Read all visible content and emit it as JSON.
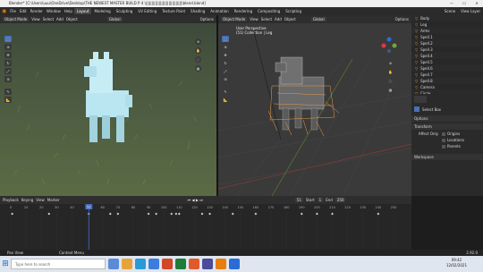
{
  "titlebar": {
    "text": "Blender* [C:\\Users\\uuu\\OneDrive\\Desktop\\THE NEWEST MASTER BUILD P 4 \\||||||||||||||||||||||||||||||\\blend.blend]"
  },
  "menubar": {
    "items": [
      "File",
      "Edit",
      "Render",
      "Window",
      "Help"
    ],
    "workspaces": [
      "Layout",
      "Modeling",
      "Sculpting",
      "UV Editing",
      "Texture Paint",
      "Shading",
      "Animation",
      "Rendering",
      "Compositing",
      "Scripting"
    ],
    "active": "Layout",
    "scene": "Scene",
    "view_layer": "View Layer"
  },
  "left_viewport": {
    "mode": "Object Mode",
    "menus": [
      "View",
      "Select",
      "Add",
      "Object"
    ],
    "transform": "Global",
    "options": "Options"
  },
  "right_viewport": {
    "mode": "Object Mode",
    "menus": [
      "View",
      "Select",
      "Add",
      "Object"
    ],
    "transform": "Global",
    "options": "Options",
    "overlay_line1": "User Perspective",
    "overlay_line2": "(51) Collection | Leg"
  },
  "outliner": {
    "rows": [
      {
        "name": "Body",
        "kind": "obj"
      },
      {
        "name": "Leg",
        "kind": "obj"
      },
      {
        "name": "Arms",
        "kind": "obj"
      },
      {
        "name": "Spell.1",
        "kind": "obj"
      },
      {
        "name": "Spell.2",
        "kind": "obj"
      },
      {
        "name": "Spell.3",
        "kind": "obj"
      },
      {
        "name": "Spell.4",
        "kind": "obj"
      },
      {
        "name": "Spell.5",
        "kind": "obj"
      },
      {
        "name": "Spell.6",
        "kind": "obj"
      },
      {
        "name": "Spell.7",
        "kind": "obj"
      },
      {
        "name": "Spell.8",
        "kind": "obj"
      },
      {
        "name": "Camera",
        "kind": "obj"
      },
      {
        "name": "Circle",
        "kind": "obj"
      },
      {
        "name": "Cube",
        "kind": "obj"
      }
    ]
  },
  "props": {
    "tool_label": "Select Box",
    "options": "Options",
    "transform": "Transform",
    "affect_only": "Affect Only",
    "checks": [
      "Origins",
      "Locations",
      "Parents"
    ],
    "workspace": "Workspace"
  },
  "timeline": {
    "menus": [
      "Playback",
      "Keying",
      "View",
      "Marker"
    ],
    "current": "51",
    "start_label": "Start",
    "start": "1",
    "end_label": "End",
    "end": "250",
    "ticks": [
      "0",
      "10",
      "20",
      "30",
      "40",
      "50",
      "60",
      "70",
      "80",
      "90",
      "100",
      "110",
      "120",
      "130",
      "140",
      "150",
      "160",
      "170",
      "180",
      "190",
      "200",
      "210",
      "220",
      "230",
      "240",
      "250"
    ],
    "keyframes": [
      1,
      25,
      51,
      65,
      70,
      90,
      95,
      105,
      108,
      110,
      125,
      130,
      145,
      160,
      190,
      200,
      210,
      240
    ]
  },
  "status": {
    "left": "Pan View",
    "mid": "Context Menu",
    "right": "2.92.0"
  },
  "taskbar": {
    "search": "Type here to search",
    "time": "09:42",
    "date": "12/02/2021"
  },
  "colors": {
    "accent": "#4772b3",
    "selected": "#e89b4a",
    "keyframe": "#d4d4d4",
    "current_frame": "#4b6cc7"
  }
}
